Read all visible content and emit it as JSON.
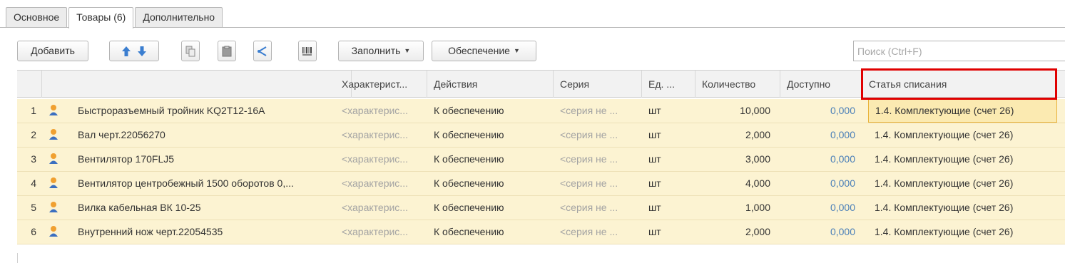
{
  "tabs": [
    {
      "label": "Основное"
    },
    {
      "label": "Товары (6)"
    },
    {
      "label": "Дополнительно"
    }
  ],
  "toolbar": {
    "add_label": "Добавить",
    "fill_label": "Заполнить",
    "supply_label": "Обеспечение",
    "search_placeholder": "Поиск (Ctrl+F)"
  },
  "table": {
    "columns": {
      "characteristic": "Характерист...",
      "actions": "Действия",
      "series": "Серия",
      "unit": "Ед. ...",
      "quantity": "Количество",
      "available": "Доступно",
      "writeoff": "Статья списания"
    },
    "rows": [
      {
        "n": "1",
        "name": "Быстроразъемный тройник KQ2T12-16A",
        "characteristic": "<характерис...",
        "action": "К обеспечению",
        "series": "<серия не ...",
        "unit": "шт",
        "quantity": "10,000",
        "available": "0,000",
        "writeoff": "1.4. Комплектующие (счет 26)"
      },
      {
        "n": "2",
        "name": "Вал черт.22056270",
        "characteristic": "<характерис...",
        "action": "К обеспечению",
        "series": "<серия не ...",
        "unit": "шт",
        "quantity": "2,000",
        "available": "0,000",
        "writeoff": "1.4. Комплектующие (счет 26)"
      },
      {
        "n": "3",
        "name": "Вентилятор 170FLJ5",
        "characteristic": "<характерис...",
        "action": "К обеспечению",
        "series": "<серия не ...",
        "unit": "шт",
        "quantity": "3,000",
        "available": "0,000",
        "writeoff": "1.4. Комплектующие (счет 26)"
      },
      {
        "n": "4",
        "name": "Вентилятор центробежный 1500 оборотов 0,...",
        "characteristic": "<характерис...",
        "action": "К обеспечению",
        "series": "<серия не ...",
        "unit": "шт",
        "quantity": "4,000",
        "available": "0,000",
        "writeoff": "1.4. Комплектующие (счет 26)"
      },
      {
        "n": "5",
        "name": "Вилка кабельная ВК 10-25",
        "characteristic": "<характерис...",
        "action": "К обеспечению",
        "series": "<серия не ...",
        "unit": "шт",
        "quantity": "1,000",
        "available": "0,000",
        "writeoff": "1.4. Комплектующие (счет 26)"
      },
      {
        "n": "6",
        "name": "Внутренний нож черт.22054535",
        "characteristic": "<характерис...",
        "action": "К обеспечению",
        "series": "<серия не ...",
        "unit": "шт",
        "quantity": "2,000",
        "available": "0,000",
        "writeoff": "1.4. Комплектующие (счет 26)"
      }
    ]
  },
  "icons": [
    "move-up-icon",
    "move-down-icon",
    "copy-icon",
    "paste-icon",
    "share-icon",
    "barcode-icon",
    "user-icon"
  ],
  "colors": {
    "row_bg": "#fcf3d2",
    "accent_blue": "#4a7fb8",
    "highlight_red": "#e00000"
  }
}
